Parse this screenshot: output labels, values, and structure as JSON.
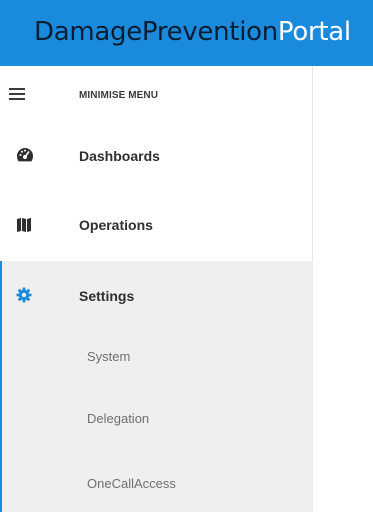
{
  "header": {
    "brand_primary": "DamagePrevention",
    "brand_secondary": "Portal",
    "brand_color": "#1a8bdc"
  },
  "sidebar": {
    "minimise_label": "MINIMISE MENU",
    "items": [
      {
        "label": "Dashboards",
        "icon": "speedometer-icon"
      },
      {
        "label": "Operations",
        "icon": "map-icon"
      },
      {
        "label": "Settings",
        "icon": "gear-icon",
        "active": true
      }
    ],
    "settings_subitems": [
      {
        "label": "System"
      },
      {
        "label": "Delegation"
      },
      {
        "label": "OneCallAccess"
      }
    ],
    "active_color": "#1a8bdc",
    "active_bg": "#efefef"
  }
}
